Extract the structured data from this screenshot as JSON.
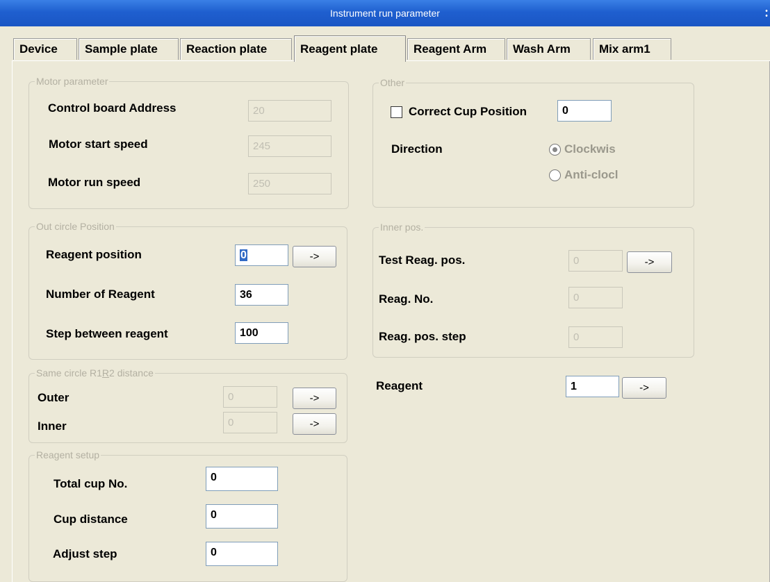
{
  "window": {
    "title": "Instrument run parameter"
  },
  "tabs": [
    {
      "label": "Device"
    },
    {
      "label": "Sample plate"
    },
    {
      "label": "Reaction plate"
    },
    {
      "label": "Reagent plate"
    },
    {
      "label": "Reagent Arm"
    },
    {
      "label": "Wash Arm"
    },
    {
      "label": "Mix arm1"
    }
  ],
  "motor": {
    "group_label": "Motor parameter",
    "control_board_label": "Control board Address",
    "control_board_value": "20",
    "start_speed_label": "Motor start speed",
    "start_speed_value": "245",
    "run_speed_label": "Motor run speed",
    "run_speed_value": "250"
  },
  "other": {
    "group_label": "Other",
    "correct_cup_label": "Correct Cup Position",
    "correct_cup_value": "0",
    "direction_label": "Direction",
    "clockwise_label": "Clockwis",
    "anticlock_label": "Anti-clocl"
  },
  "out_circle": {
    "group_label": "Out circle Position",
    "reagent_position_label": "Reagent position",
    "reagent_position_value": "0",
    "number_label": "Number of Reagent",
    "number_value": "36",
    "step_label": "Step between reagent",
    "step_value": "100",
    "go_button": "->"
  },
  "inner_pos": {
    "group_label": "Inner pos.",
    "test_reag_label": "Test Reag. pos.",
    "test_reag_value": "0",
    "reag_no_label": "Reag. No.",
    "reag_no_value": "0",
    "reag_step_label": "Reag. pos. step",
    "reag_step_value": "0",
    "go_button": "->"
  },
  "same_circle": {
    "group_label_pre": "Same circle R1",
    "group_label_u": "R",
    "group_label_post": "2 distance",
    "outer_label": "Outer",
    "outer_value": "0",
    "inner_label": "Inner",
    "inner_value": "0",
    "go_button": "->"
  },
  "reagent": {
    "label": "Reagent",
    "value": "1",
    "go_button": "->"
  },
  "reagent_setup": {
    "group_label": "Reagent setup",
    "total_cup_label": "Total cup No.",
    "total_cup_value": "0",
    "cup_distance_label": "Cup distance",
    "cup_distance_value": "0",
    "adjust_step_label": "Adjust step",
    "adjust_step_value": "0"
  },
  "colors": {
    "titlebar": "#1f5fcf",
    "dialog_bg": "#ece9d8",
    "selection": "#316ac5"
  }
}
